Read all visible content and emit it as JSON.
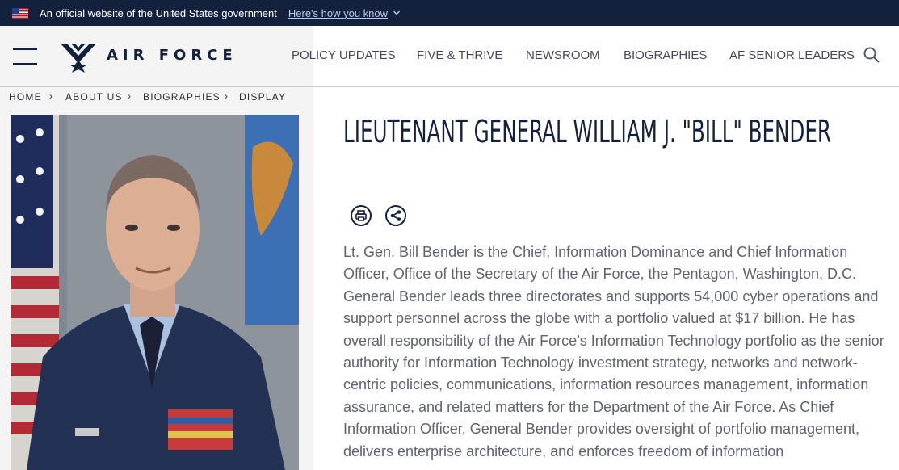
{
  "gov_banner": {
    "official_text": "An official website of the United States government",
    "how_link": "Here's how you know"
  },
  "header": {
    "logo_text": "AIR FORCE",
    "nav": [
      "POLICY UPDATES",
      "FIVE & THRIVE",
      "NEWSROOM",
      "BIOGRAPHIES",
      "AF SENIOR LEADERS"
    ]
  },
  "breadcrumb": [
    "HOME",
    "ABOUT US",
    "BIOGRAPHIES",
    "DISPLAY"
  ],
  "article": {
    "title": "LIEUTENANT GENERAL WILLIAM J. \"BILL\" BENDER",
    "body": "Lt. Gen. Bill Bender is the Chief, Information Dominance and Chief Information Officer, Office of the Secretary of the Air Force, the Pentagon, Washington, D.C. General Bender leads three directorates and supports 54,000 cyber operations and support personnel across the globe with a portfolio valued at $17 billion. He has overall responsibility of the Air Force’s Information Technology portfolio as the senior authority for Information Technology investment strategy, networks and network-centric policies, communications, information resources management, information assurance, and related matters for the Department of the Air Force. As Chief Information Officer, General Bender provides oversight of portfolio management, delivers enterprise architecture, and enforces freedom of information"
  },
  "icons": {
    "flag": "us-flag-icon",
    "chevron": "chevron-down-icon",
    "menu": "hamburger-menu-icon",
    "search": "search-icon",
    "print": "print-icon",
    "share": "share-icon"
  },
  "colors": {
    "navy": "#14213d",
    "panel_gray": "#f4f4f4",
    "body_text": "#5f6370",
    "link": "#b7c9ef"
  }
}
